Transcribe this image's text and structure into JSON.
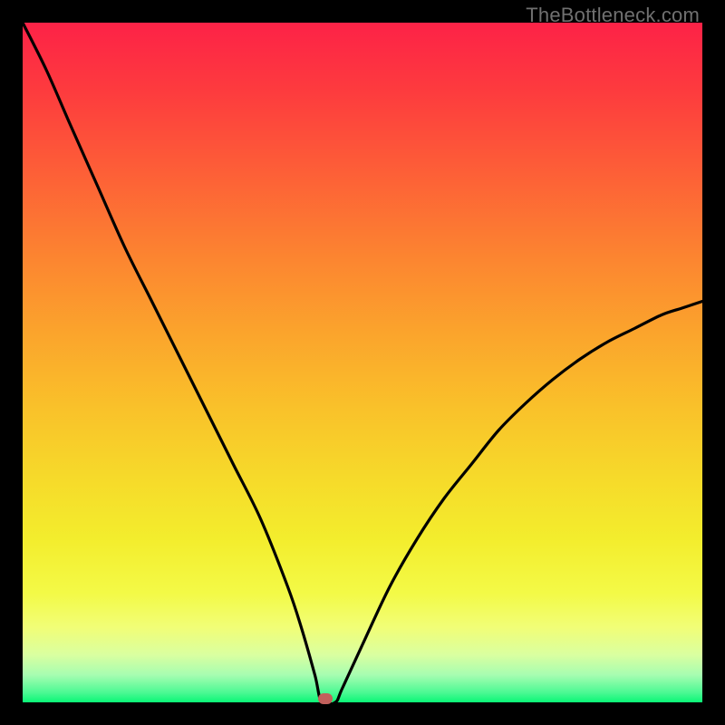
{
  "watermark": "TheBottleneck.com",
  "colors": {
    "frame": "#000000",
    "curve": "#000000",
    "marker": "#c2605c",
    "gradient_stops": [
      {
        "offset": 0.0,
        "hex": "#fd2247"
      },
      {
        "offset": 0.1,
        "hex": "#fd3b3e"
      },
      {
        "offset": 0.22,
        "hex": "#fd5f37"
      },
      {
        "offset": 0.35,
        "hex": "#fc8630"
      },
      {
        "offset": 0.46,
        "hex": "#fba52c"
      },
      {
        "offset": 0.57,
        "hex": "#f9c22a"
      },
      {
        "offset": 0.67,
        "hex": "#f6da2a"
      },
      {
        "offset": 0.76,
        "hex": "#f3ed2d"
      },
      {
        "offset": 0.84,
        "hex": "#f3fa47"
      },
      {
        "offset": 0.89,
        "hex": "#f1fe77"
      },
      {
        "offset": 0.93,
        "hex": "#daffa0"
      },
      {
        "offset": 0.96,
        "hex": "#a6fdb1"
      },
      {
        "offset": 0.985,
        "hex": "#4ef994"
      },
      {
        "offset": 1.0,
        "hex": "#0af676"
      }
    ]
  },
  "chart_data": {
    "type": "line",
    "title": "",
    "xlabel": "",
    "ylabel": "",
    "xlim": [
      0,
      1
    ],
    "ylim": [
      0,
      1
    ],
    "note": "Values are normalized 0–1. y≈1 at left edge, curve descends to y≈0 near x≈0.44 then rises to y≈0.59 at x=1.",
    "series": [
      {
        "name": "bottleneck-curve",
        "x": [
          0.0,
          0.035,
          0.07,
          0.11,
          0.15,
          0.19,
          0.23,
          0.27,
          0.31,
          0.35,
          0.39,
          0.41,
          0.43,
          0.44,
          0.46,
          0.47,
          0.5,
          0.54,
          0.58,
          0.62,
          0.66,
          0.7,
          0.74,
          0.78,
          0.82,
          0.86,
          0.9,
          0.94,
          0.97,
          1.0
        ],
        "y": [
          1.0,
          0.93,
          0.85,
          0.76,
          0.67,
          0.59,
          0.51,
          0.43,
          0.35,
          0.27,
          0.17,
          0.11,
          0.04,
          0.0,
          0.0,
          0.02,
          0.085,
          0.17,
          0.24,
          0.3,
          0.35,
          0.4,
          0.44,
          0.475,
          0.505,
          0.53,
          0.55,
          0.57,
          0.58,
          0.59
        ]
      }
    ],
    "marker": {
      "x": 0.445,
      "y": 0.003
    },
    "flat_segment": {
      "x0": 0.425,
      "x1": 0.46,
      "y": 0.0
    }
  }
}
